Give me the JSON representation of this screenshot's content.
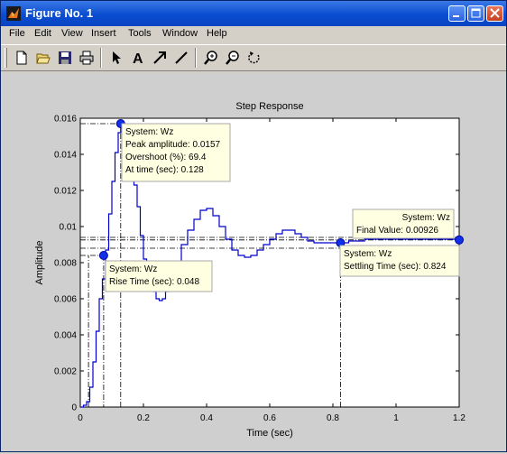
{
  "window": {
    "title": "Figure No. 1",
    "buttons": [
      "minimize",
      "maximize",
      "close"
    ]
  },
  "menu": [
    "File",
    "Edit",
    "View",
    "Insert",
    "Tools",
    "Window",
    "Help"
  ],
  "toolbar": {
    "icons": [
      "new-file-icon",
      "open-folder-icon",
      "save-icon",
      "print-icon",
      "select-arrow-icon",
      "insert-text-icon",
      "insert-arrow-icon",
      "insert-line-icon",
      "zoom-in-icon",
      "zoom-out-icon",
      "rotate-icon"
    ],
    "text_tool_label": "A"
  },
  "chart_data": {
    "type": "line",
    "title": "Step Response",
    "xlabel": "Time (sec)",
    "ylabel": "Amplitude",
    "xlim": [
      0,
      1.2
    ],
    "ylim": [
      0,
      0.016
    ],
    "xticks": [
      "0",
      "0.2",
      "0.4",
      "0.6",
      "0.8",
      "1",
      "1.2"
    ],
    "yticks": [
      "0",
      "0.002",
      "0.004",
      "0.006",
      "0.008",
      "0.01",
      "0.012",
      "0.014",
      "0.016"
    ],
    "grid": false,
    "series": [
      {
        "name": "System: Wz",
        "color": "#0000cc",
        "x": [
          0,
          0.01,
          0.02,
          0.03,
          0.04,
          0.05,
          0.06,
          0.07,
          0.08,
          0.09,
          0.1,
          0.11,
          0.12,
          0.128,
          0.135,
          0.14,
          0.15,
          0.16,
          0.17,
          0.18,
          0.19,
          0.2,
          0.21,
          0.22,
          0.23,
          0.24,
          0.25,
          0.26,
          0.27,
          0.28,
          0.3,
          0.32,
          0.34,
          0.36,
          0.38,
          0.4,
          0.42,
          0.44,
          0.46,
          0.48,
          0.5,
          0.52,
          0.54,
          0.56,
          0.58,
          0.6,
          0.62,
          0.64,
          0.66,
          0.68,
          0.7,
          0.72,
          0.74,
          0.76,
          0.78,
          0.8,
          0.824,
          0.85,
          0.9,
          0.95,
          1.0,
          1.05,
          1.1,
          1.15,
          1.2
        ],
        "y": [
          0,
          0.0001,
          0.0003,
          0.0011,
          0.0025,
          0.0042,
          0.006,
          0.0071,
          0.0087,
          0.0107,
          0.0125,
          0.0141,
          0.0152,
          0.0157,
          0.0155,
          0.015,
          0.0142,
          0.0134,
          0.0123,
          0.0111,
          0.0095,
          0.0082,
          0.0075,
          0.0069,
          0.0064,
          0.006,
          0.0059,
          0.006,
          0.0064,
          0.0069,
          0.008,
          0.009,
          0.0098,
          0.0104,
          0.0109,
          0.011,
          0.0106,
          0.01,
          0.0093,
          0.0087,
          0.0084,
          0.0083,
          0.0084,
          0.0087,
          0.009,
          0.0093,
          0.0096,
          0.0098,
          0.0098,
          0.0096,
          0.0094,
          0.0092,
          0.0091,
          0.0091,
          0.0091,
          0.0091,
          0.0091,
          0.0092,
          0.0093,
          0.0093,
          0.0093,
          0.0093,
          0.0093,
          0.0093,
          0.00926
        ]
      }
    ],
    "final_value": 0.00926,
    "settling_band": [
      0.0088,
      0.0094
    ],
    "markers": [
      {
        "name": "peak",
        "x": 0.128,
        "y": 0.0157
      },
      {
        "name": "rise",
        "x": 0.074,
        "y": 0.0084
      },
      {
        "name": "settling",
        "x": 0.824,
        "y": 0.0091
      },
      {
        "name": "final",
        "x": 1.2,
        "y": 0.00926
      }
    ],
    "rise_time_start": 0.026,
    "annotations": [
      {
        "name": "peak",
        "lines": [
          "System: Wz",
          "Peak amplitude: 0.0157",
          "Overshoot (%): 69.4",
          "At time (sec): 0.128"
        ]
      },
      {
        "name": "rise",
        "lines": [
          "System: Wz",
          "Rise Time (sec): 0.048"
        ]
      },
      {
        "name": "final",
        "lines": [
          "System: Wz",
          "Final Value: 0.00926"
        ]
      },
      {
        "name": "settling",
        "lines": [
          "System: Wz",
          "Settling Time (sec): 0.824"
        ]
      }
    ]
  }
}
